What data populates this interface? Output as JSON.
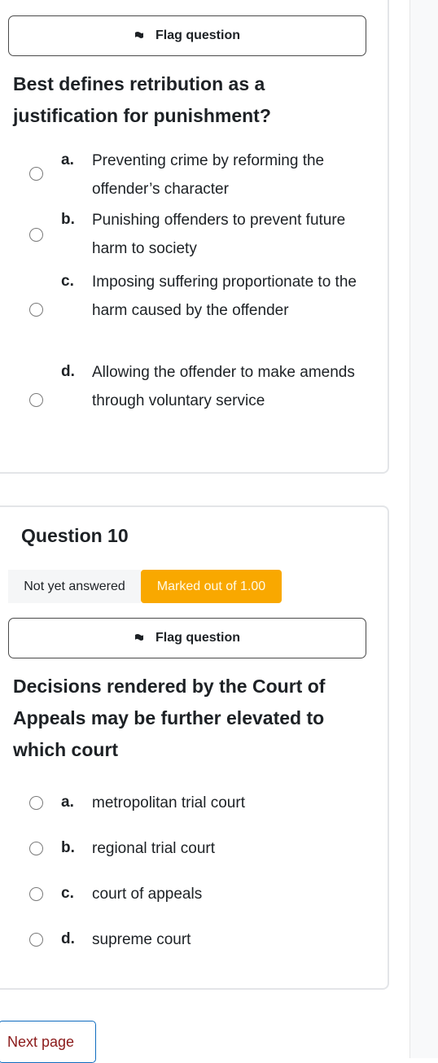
{
  "question9": {
    "flag_label": "Flag question",
    "text": "Best defines retribution as a justification for punishment?",
    "options": [
      {
        "letter": "a.",
        "text": "Preventing crime by reforming the offender’s character"
      },
      {
        "letter": "b.",
        "text": "Punishing offenders to prevent future harm to society"
      },
      {
        "letter": "c.",
        "text": "Imposing suffering proportionate to the harm caused by the offender"
      },
      {
        "letter": "d.",
        "text": "Allowing the offender to make amends through voluntary service"
      }
    ]
  },
  "question10": {
    "title": "Question 10",
    "state": "Not yet answered",
    "marks": "Marked out of 1.00",
    "flag_label": "Flag question",
    "text": "Decisions rendered by the Court of Appeals may be further elevated to which court",
    "options": [
      {
        "letter": "a.",
        "text": "metropolitan trial court"
      },
      {
        "letter": "b.",
        "text": "regional trial court"
      },
      {
        "letter": "c.",
        "text": "court of appeals"
      },
      {
        "letter": "d.",
        "text": "supreme court"
      }
    ]
  },
  "nav": {
    "next_label": "Next page"
  },
  "colors": {
    "accent": "#f9a800",
    "link": "#8b1a1a",
    "border": "#0f6cbf"
  },
  "icons": {
    "flag": "flag-icon",
    "radio": "radio-icon"
  }
}
